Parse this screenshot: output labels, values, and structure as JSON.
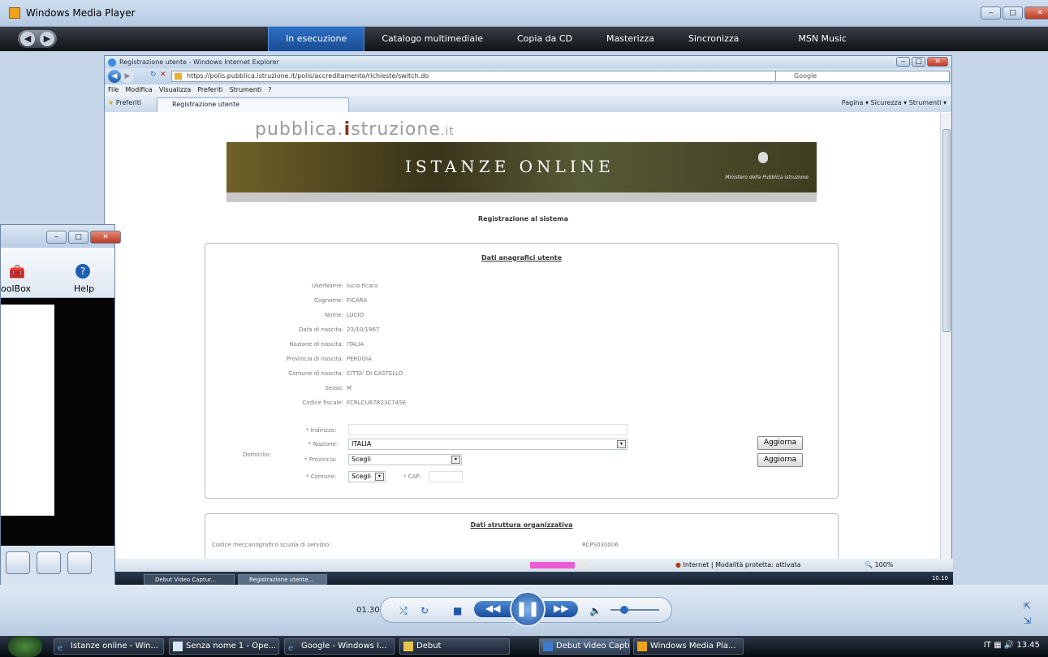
{
  "wmp": {
    "title": "Windows Media Player",
    "nav_tabs": [
      "In esecuzione",
      "Catalogo multimediale",
      "Copia da CD",
      "Masterizza",
      "Sincronizza",
      "MSN Music"
    ],
    "time": "01.30"
  },
  "ie": {
    "title": "Registrazione utente - Windows Internet Explorer",
    "url": "https://polis.pubblica.istruzione.it/polis/accreditamento/richieste/switch.do",
    "search_placeholder": "Google",
    "menu": [
      "File",
      "Modifica",
      "Visualizza",
      "Preferiti",
      "Strumenti",
      "?"
    ],
    "favorites_label": "Preferiti",
    "tab_label": "Registrazione utente",
    "command_bar": "Pagina ▾  Sicurezza ▾  Strumenti ▾",
    "status_zone": "Internet | Modalità protetta: attivata",
    "zoom": "100%",
    "inner_taskbar": {
      "items": [
        "Debut Video Captur...",
        "Registrazione utente..."
      ],
      "clock": "10.10"
    }
  },
  "page": {
    "logo_prefix": "pubblica.",
    "logo_i": "i",
    "logo_suffix": "struzione",
    "logo_tld": ".it",
    "banner_text": "ISTANZE ONLINE",
    "banner_ministry": "Ministero della Pubblica Istruzione",
    "title": "Registrazione al sistema",
    "section1": {
      "legend": "Dati anagrafici utente",
      "fields": [
        {
          "label": "UserName:",
          "value": "lucio.ficara"
        },
        {
          "label": "Cognome:",
          "value": "FICARA"
        },
        {
          "label": "Nome:",
          "value": "LUCIO"
        },
        {
          "label": "Data di nascita:",
          "value": "23/10/1967"
        },
        {
          "label": "Nazione di nascita:",
          "value": "ITALIA"
        },
        {
          "label": "Provincia di nascita:",
          "value": "PERUGIA"
        },
        {
          "label": "Comune di nascita:",
          "value": "CITTA' DI CASTELLO"
        },
        {
          "label": "Sesso:",
          "value": "M"
        },
        {
          "label": "Codice fiscale:",
          "value": "FCRLCU67R23C745E"
        }
      ],
      "domicilio_label": "Domicilio:",
      "indirizzo_label": "* Indirizzo:",
      "indirizzo_value": "",
      "nazione_label": "* Nazione:",
      "nazione_value": "ITALIA",
      "provincia_label": "* Provincia:",
      "provincia_value": "Scegli",
      "comune_label": "* Comune:",
      "comune_value": "Scegli",
      "cap_label": "* CAP:",
      "aggiorna1": "Aggiorna",
      "aggiorna2": "Aggiorna"
    },
    "section2": {
      "legend": "Dati struttura organizzativa",
      "codice_label": "Codice meccanografico scuola di servizio:",
      "codice_value": "RCPS030006"
    }
  },
  "left_window": {
    "toolbox_label": "oolBox",
    "help_label": "Help"
  },
  "taskbar": {
    "items": [
      "Istanze online - Win...",
      "Senza nome 1 - Ope...",
      "Google - Windows I...",
      "Debut",
      "Debut Video Captur...",
      "Windows Media Pla..."
    ],
    "lang": "IT",
    "clock": "13.45"
  }
}
